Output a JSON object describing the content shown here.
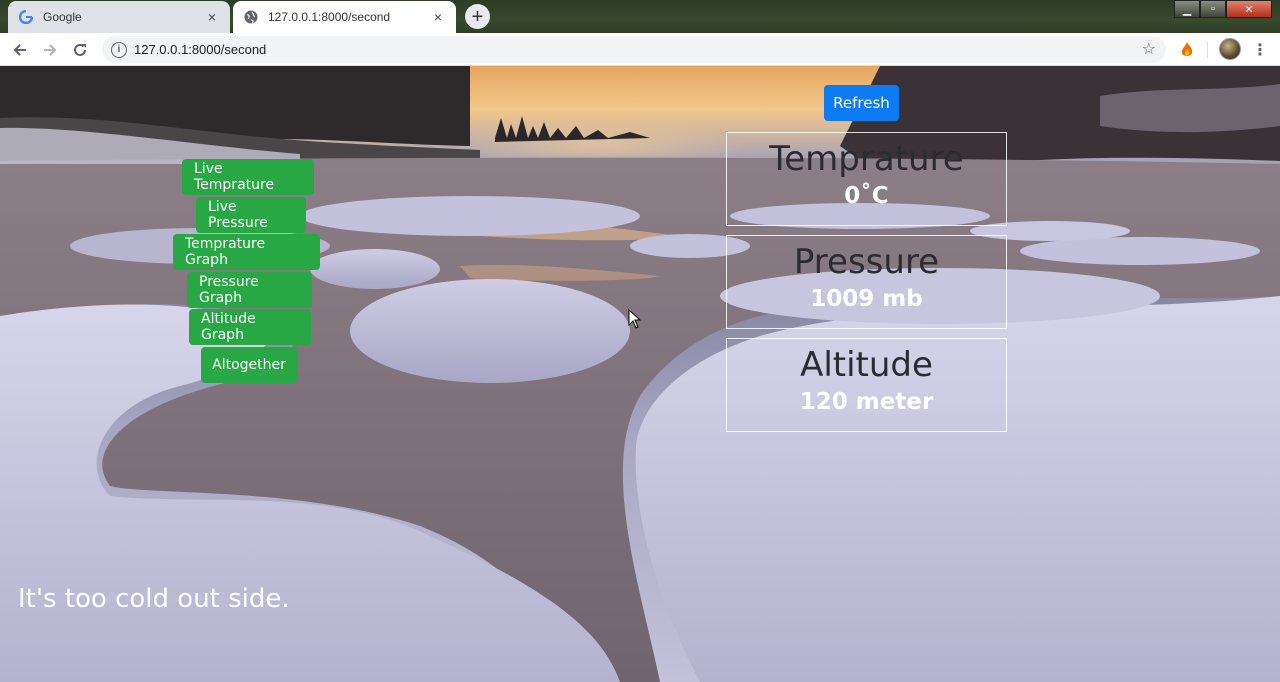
{
  "browser": {
    "tabs": [
      {
        "title": "Google",
        "close": "×"
      },
      {
        "title": "127.0.0.1:8000/second",
        "close": "×"
      }
    ],
    "new_tab": "+",
    "url": "127.0.0.1:8000/second"
  },
  "page": {
    "refresh_label": "Refresh",
    "nav_buttons": [
      "Live Temprature",
      "Live Pressure",
      "Temprature Graph",
      "Pressure Graph",
      "Altitude Graph",
      "Altogether"
    ],
    "readings": [
      {
        "label": "Temprature",
        "value": "0˚C"
      },
      {
        "label": "Pressure",
        "value": "1009 mb"
      },
      {
        "label": "Altitude",
        "value": "120 meter"
      }
    ],
    "message": "It's too cold out side."
  },
  "colors": {
    "refresh_button": "#0d7bf2",
    "nav_button": "#28a745"
  }
}
